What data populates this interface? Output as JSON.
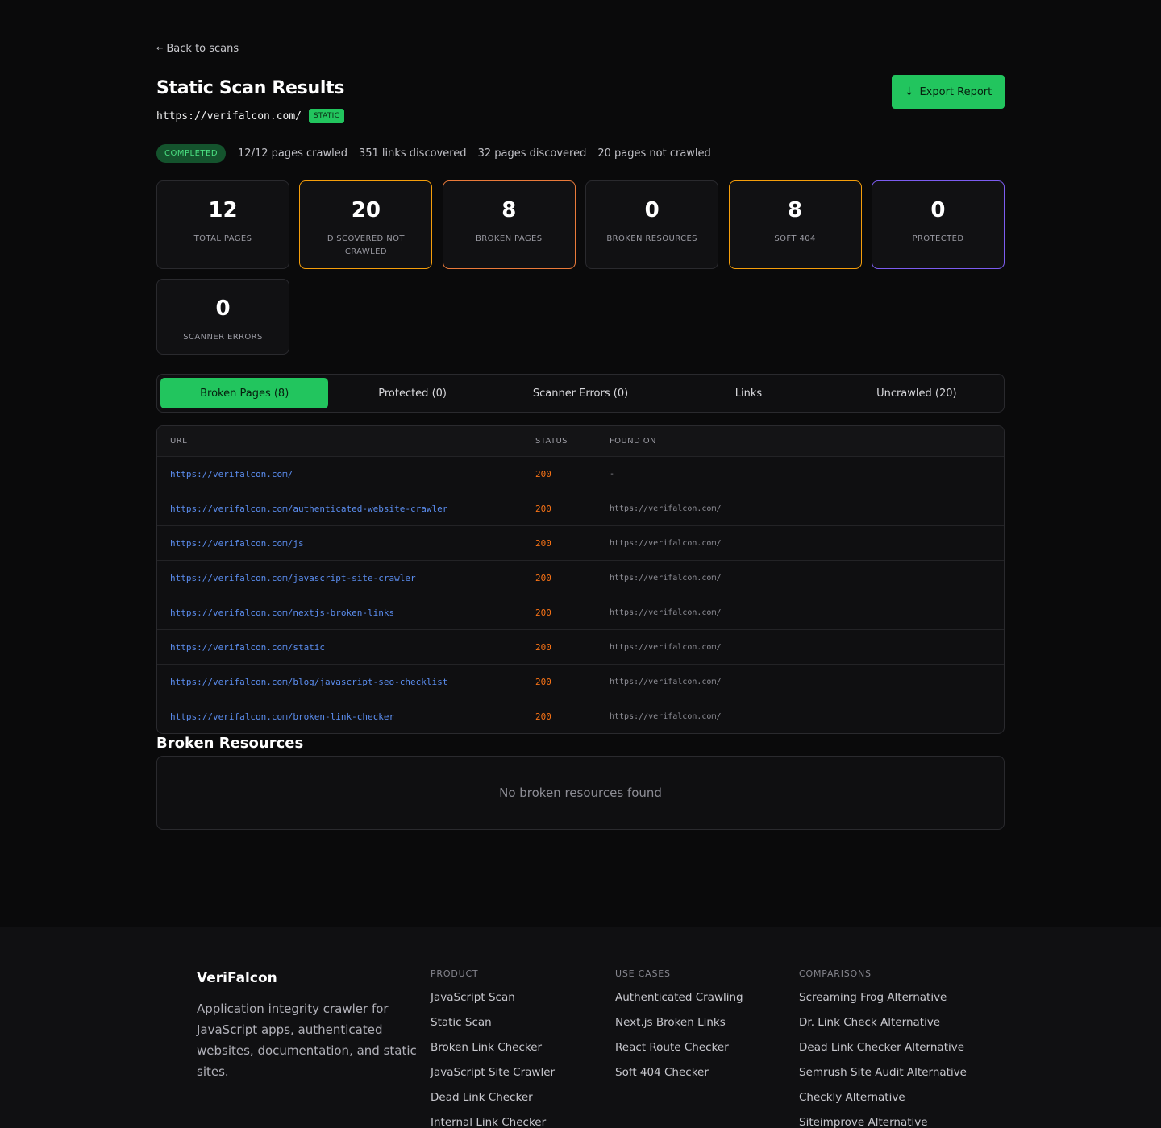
{
  "nav": {
    "back_arrow": "←",
    "back_label": "Back to scans"
  },
  "header": {
    "title": "Static Scan Results",
    "url": "https://verifalcon.com/",
    "scan_type": "STATIC",
    "export_icon": "download-arrow-icon",
    "export_glyph": "↓",
    "export_label": "Export Report"
  },
  "status": {
    "state": "COMPLETED",
    "pages_crawled": "12/12 pages crawled",
    "links_discovered": "351 links discovered",
    "pages_discovered": "32 pages discovered",
    "pages_not_crawled": "20 pages not crawled"
  },
  "stats": [
    {
      "value": "12",
      "label": "TOTAL PAGES"
    },
    {
      "value": "20",
      "label": "DISCOVERED NOT CRAWLED"
    },
    {
      "value": "8",
      "label": "BROKEN PAGES"
    },
    {
      "value": "0",
      "label": "BROKEN RESOURCES"
    },
    {
      "value": "8",
      "label": "SOFT 404"
    },
    {
      "value": "0",
      "label": "PROTECTED"
    },
    {
      "value": "0",
      "label": "SCANNER ERRORS"
    }
  ],
  "colors": {
    "accent": "#22c55e",
    "warning_border": "#f59e0b",
    "broken_border": "#ea7a3a",
    "protected_border": "#7c5cf0",
    "link": "#5b8def",
    "status_code": "#f97316"
  },
  "tabs": [
    {
      "label": "Broken Pages (8)",
      "active": true
    },
    {
      "label": "Protected (0)",
      "active": false
    },
    {
      "label": "Scanner Errors (0)",
      "active": false
    },
    {
      "label": "Links",
      "active": false
    },
    {
      "label": "Uncrawled (20)",
      "active": false
    }
  ],
  "table": {
    "columns": [
      "URL",
      "STATUS",
      "FOUND ON"
    ],
    "rows": [
      {
        "url": "https://verifalcon.com/",
        "status": "200",
        "found_on": "-"
      },
      {
        "url": "https://verifalcon.com/authenticated-website-crawler",
        "status": "200",
        "found_on": "https://verifalcon.com/"
      },
      {
        "url": "https://verifalcon.com/js",
        "status": "200",
        "found_on": "https://verifalcon.com/"
      },
      {
        "url": "https://verifalcon.com/javascript-site-crawler",
        "status": "200",
        "found_on": "https://verifalcon.com/"
      },
      {
        "url": "https://verifalcon.com/nextjs-broken-links",
        "status": "200",
        "found_on": "https://verifalcon.com/"
      },
      {
        "url": "https://verifalcon.com/static",
        "status": "200",
        "found_on": "https://verifalcon.com/"
      },
      {
        "url": "https://verifalcon.com/blog/javascript-seo-checklist",
        "status": "200",
        "found_on": "https://verifalcon.com/"
      },
      {
        "url": "https://verifalcon.com/broken-link-checker",
        "status": "200",
        "found_on": "https://verifalcon.com/"
      }
    ]
  },
  "broken_resources": {
    "title": "Broken Resources",
    "empty_message": "No broken resources found"
  },
  "footer": {
    "brand": "VeriFalcon",
    "description": "Application integrity crawler for JavaScript apps, authenticated websites, documentation, and static sites.",
    "columns": [
      {
        "heading": "PRODUCT",
        "links": [
          "JavaScript Scan",
          "Static Scan",
          "Broken Link Checker",
          "JavaScript Site Crawler",
          "Dead Link Checker",
          "Internal Link Checker"
        ]
      },
      {
        "heading": "USE CASES",
        "links": [
          "Authenticated Crawling",
          "Next.js Broken Links",
          "React Route Checker",
          "Soft 404 Checker"
        ]
      },
      {
        "heading": "COMPARISONS",
        "links": [
          "Screaming Frog Alternative",
          "Dr. Link Check Alternative",
          "Dead Link Checker Alternative",
          "Semrush Site Audit Alternative",
          "Checkly Alternative",
          "Siteimprove Alternative"
        ]
      }
    ]
  }
}
